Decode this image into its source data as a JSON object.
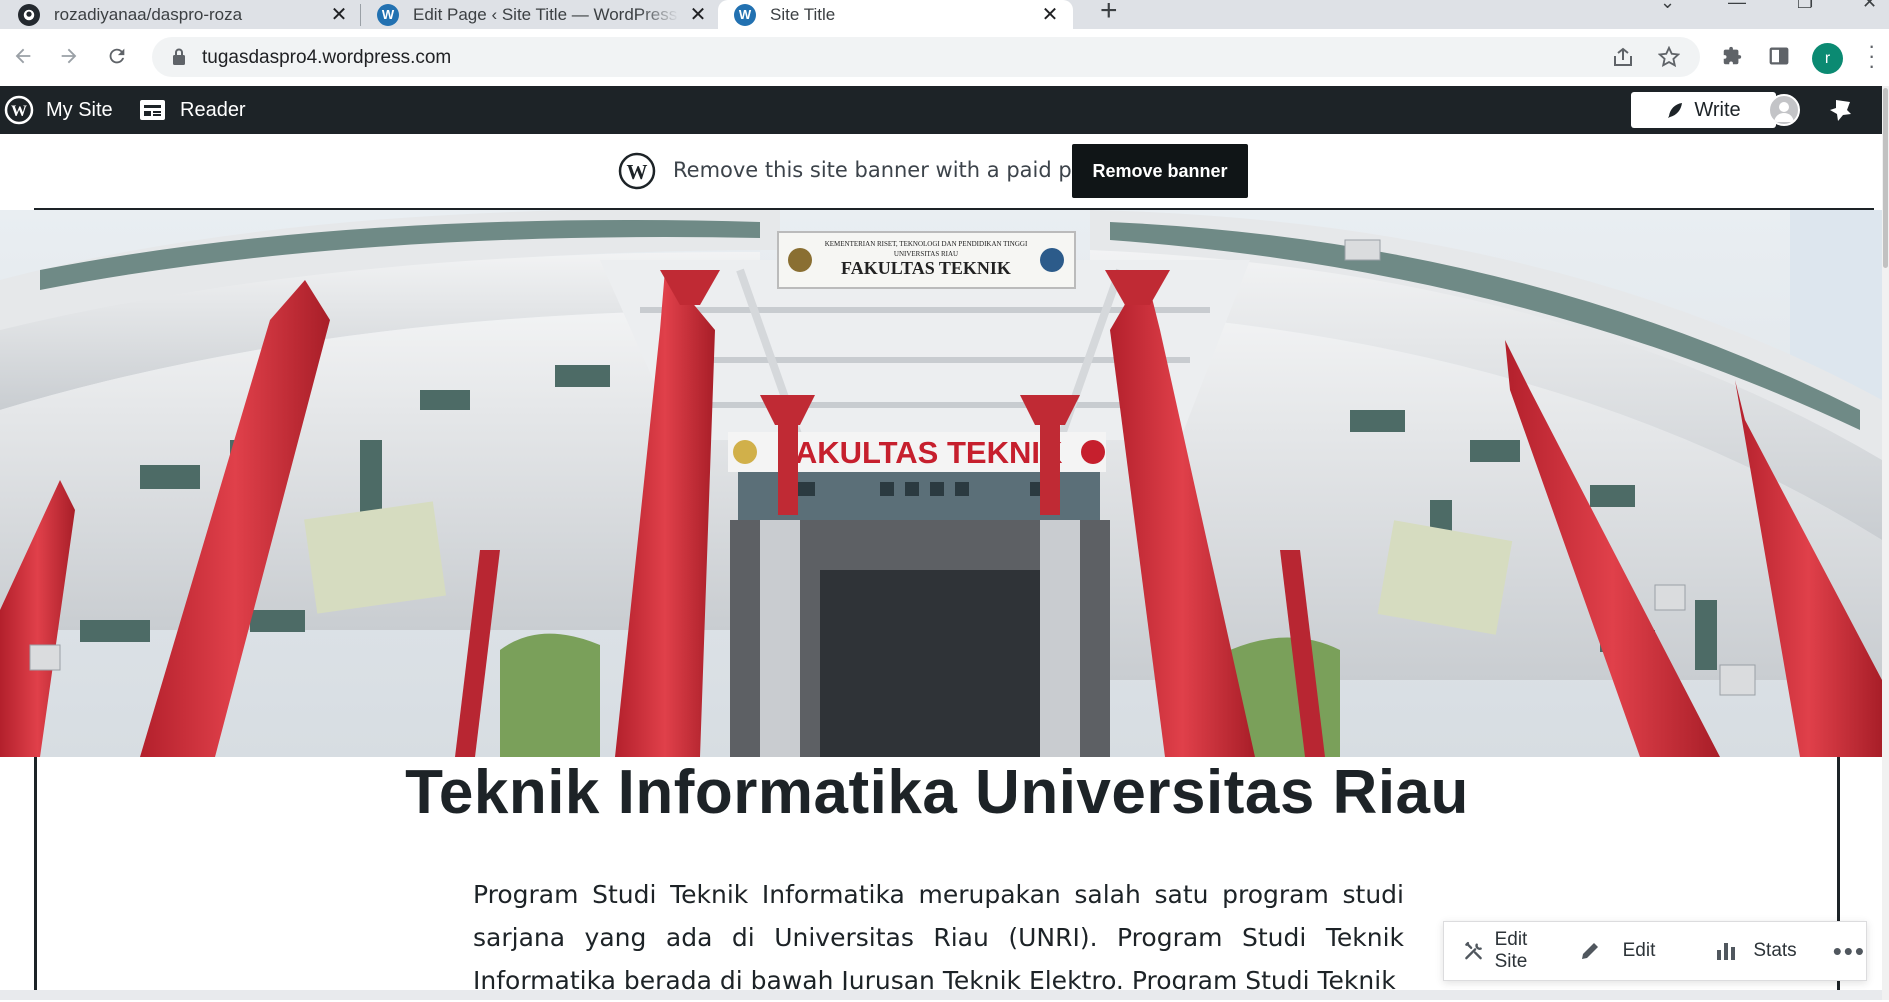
{
  "browser": {
    "tabs": [
      {
        "title": "rozadiyanaa/daspro-roza",
        "icon": "github-icon"
      },
      {
        "title": "Edit Page ‹ Site Title — WordPress.com",
        "icon": "wordpress-icon"
      },
      {
        "title": "Site Title",
        "icon": "wordpress-icon"
      }
    ],
    "url": "tugasdaspro4.wordpress.com",
    "profile_initial": "r"
  },
  "adminbar": {
    "my_site": "My Site",
    "reader": "Reader",
    "write": "Write"
  },
  "banner": {
    "message": "Remove this site banner with a paid plan",
    "button": "Remove banner"
  },
  "hero": {
    "sign_top_line1": "KEMENTERIAN RISET, TEKNOLOGI DAN PENDIDIKAN TINGGI",
    "sign_top_line2": "UNIVERSITAS RIAU",
    "sign_top_main": "FAKULTAS TEKNIK",
    "sign_gate": "FAKULTAS TEKNIK"
  },
  "page": {
    "title": "Teknik Informatika Universitas Riau",
    "paragraph": "Program Studi Teknik Informatika merupakan salah satu program studi sarjana yang ada di Universitas Riau (UNRI). Program Studi Teknik Informatika berada di bawah Jurusan Teknik Elektro. Program Studi Teknik"
  },
  "actions": {
    "edit_site": "Edit Site",
    "edit": "Edit",
    "stats": "Stats"
  },
  "colors": {
    "admin_bar": "#1d2327",
    "pillar_red": "#d2323c",
    "profile_green": "#0b8a72"
  }
}
